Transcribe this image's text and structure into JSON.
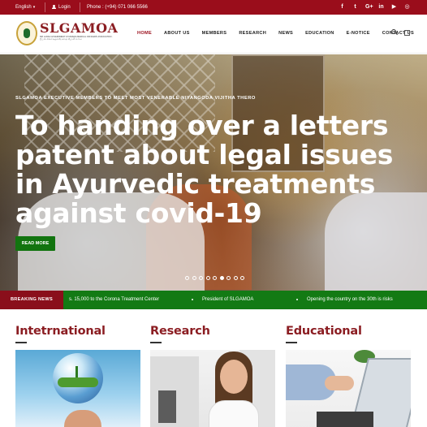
{
  "topbar": {
    "language": "English",
    "login": "Login",
    "phone": "Phone : (+94) 071 066 5566",
    "social": [
      {
        "icon": "facebook-icon",
        "glyph": "f"
      },
      {
        "icon": "twitter-icon",
        "glyph": "t"
      },
      {
        "icon": "google-plus-icon",
        "glyph": "G+"
      },
      {
        "icon": "linkedin-icon",
        "glyph": "in"
      },
      {
        "icon": "youtube-icon",
        "glyph": "▶"
      },
      {
        "icon": "instagram-icon",
        "glyph": "◎"
      }
    ]
  },
  "brand": {
    "name": "SLGAMOA",
    "subtitle": "SRI LANKA GOVERNMENT AYURVEDA MEDICAL OFFICERS' ASSOCIATION · ශ්‍රී ලංකා රජයේ ආයුර්වේද වෛද්‍ය නිලධාරී සංගමය"
  },
  "nav": [
    "HOME",
    "ABOUT US",
    "MEMBERS",
    "RESEARCH",
    "NEWS",
    "EDUCATION",
    "E-NOTICE",
    "CONTACT US"
  ],
  "hero": {
    "kicker": "SLGAMOA EXECUTIVE MEMBERS TO MEET MOST VENERABLE NIYANGODA VIJITHA THERO",
    "headline": "To handing over a letters patent about legal issues in Ayurvedic treatments against covid-19",
    "button": "READ MORE",
    "slides": 9,
    "active_slide": 6
  },
  "breaking": {
    "label": "BREAKING NEWS",
    "items": [
      "s. 15,000 to the Corona Treatment Center",
      "President of SLGAMOA",
      "Opening the country on the 30th is risks"
    ]
  },
  "sections": [
    {
      "title": "Intetrnational"
    },
    {
      "title": "Research"
    },
    {
      "title": "Educational"
    }
  ],
  "colors": {
    "maroon": "#9a0d1b",
    "green": "#137a14",
    "title": "#8b1d22"
  }
}
